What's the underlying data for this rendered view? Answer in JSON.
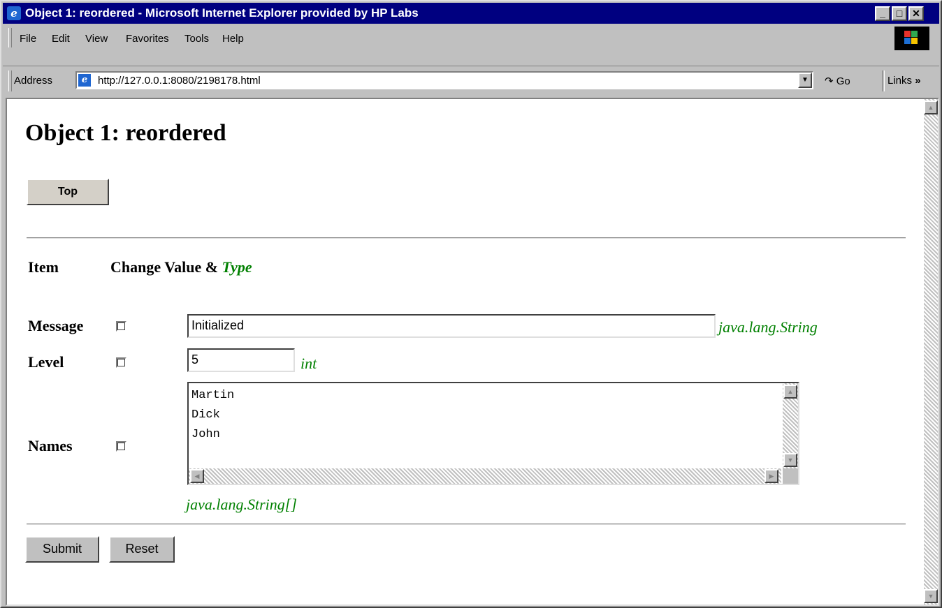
{
  "window": {
    "title": "Object 1: reordered - Microsoft Internet Explorer provided by HP Labs",
    "icon": "ie-icon",
    "caption_buttons": [
      "minimize",
      "maximize",
      "close"
    ]
  },
  "menu": {
    "items": [
      {
        "label": "File"
      },
      {
        "label": "Edit"
      },
      {
        "label": "View"
      },
      {
        "label": "Favorites"
      },
      {
        "label": "Tools"
      },
      {
        "label": "Help"
      }
    ]
  },
  "address_bar": {
    "label": "Address",
    "url": "http://127.0.0.1:8080/2198178.html",
    "go_label": "Go",
    "links_label": "Links"
  },
  "page": {
    "heading": "Object 1: reordered",
    "top_button": "Top",
    "header_item": "Item",
    "header_change": "Change Value &",
    "header_type": "Type",
    "fields": {
      "message": {
        "label": "Message",
        "value": "Initialized",
        "type": "java.lang.String",
        "checked": false
      },
      "level": {
        "label": "Level",
        "value": "5",
        "type": "int",
        "checked": false
      },
      "names": {
        "label": "Names",
        "lines": [
          "Martin",
          "Dick",
          "John"
        ],
        "type": "java.lang.String[]",
        "checked": false
      }
    },
    "submit_label": "Submit",
    "reset_label": "Reset"
  },
  "colors": {
    "titlebar": "#000080",
    "type_text": "#008000",
    "chrome": "#c0c0c0"
  }
}
